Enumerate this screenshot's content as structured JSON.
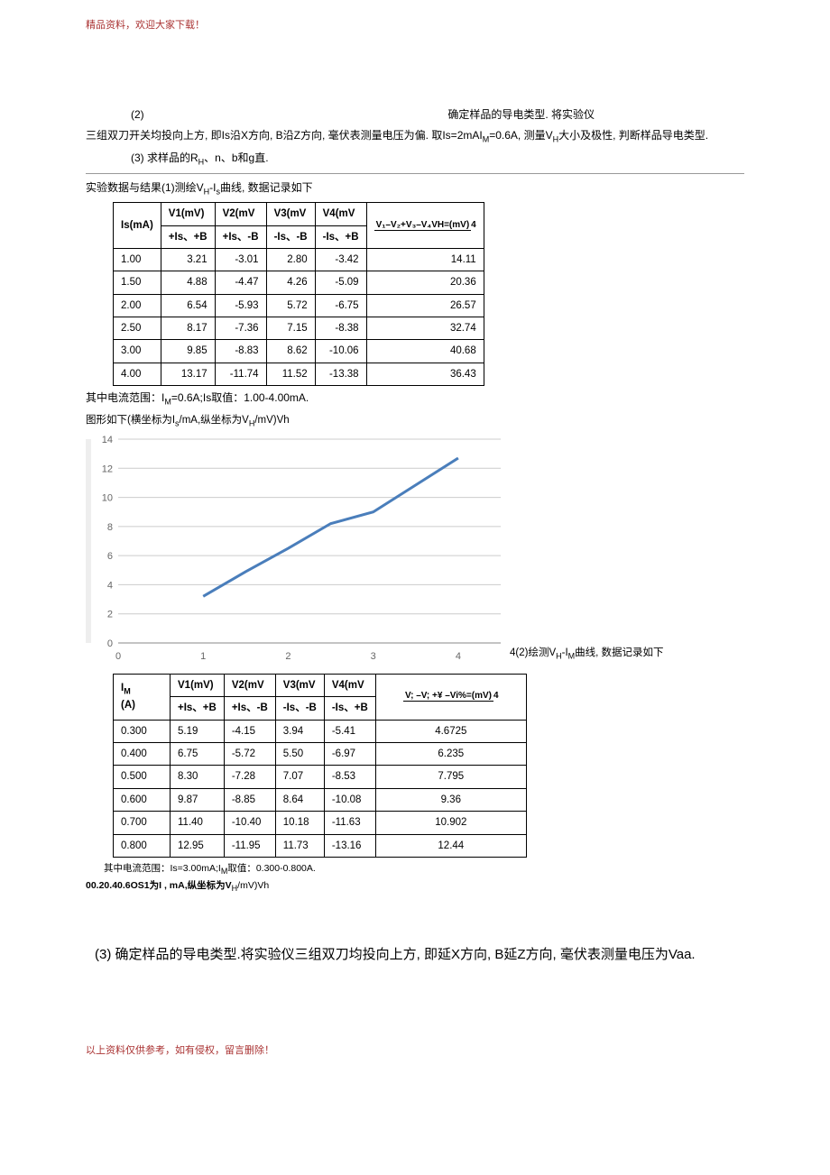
{
  "header_note": "精品资料，欢迎大家下载！",
  "footer_note": "以上资料仅供参考，如有侵权，留言删除！",
  "para_2_label": "(2)",
  "para_2_text_a": "确定样品的导电类型. 将实验仪",
  "para_2_text_b": "三组双刀开关均投向上方, 即Is沿X方向, B沿Z方向, 毫伏表测量电压为偏. 取Is=2mAI",
  "para_2_text_b2": "=0.6A, 测量V",
  "para_2_text_b3": "大小及极性, 判断样品导电类型.",
  "para_3": "(3)  求样品的R",
  "para_3_tail": "、n、b和g直.",
  "section_results_title": "实验数据与结果(1)测绘V",
  "section_results_tail": "曲线, 数据记录如下",
  "table1": {
    "head_Is": "Is(mA)",
    "head_V1": "V1(mV)",
    "head_V2": "V2(mV",
    "head_V3": "V3(mV",
    "head_V4": "V4(mV",
    "head_VH_num": "V₁–V₂+V₃–V₄VH=(mV)",
    "head_VH_den": "4",
    "sub_V1": "+Is、+B",
    "sub_V2": "+Is、-B",
    "sub_V3": "-Is、-B",
    "sub_V4": "-Is、+B",
    "rows": [
      {
        "is": "1.00",
        "v1": "3.21",
        "v2": "-3.01",
        "v3": "2.80",
        "v4": "-3.42",
        "vh": "14.11"
      },
      {
        "is": "1.50",
        "v1": "4.88",
        "v2": "-4.47",
        "v3": "4.26",
        "v4": "-5.09",
        "vh": "20.36"
      },
      {
        "is": "2.00",
        "v1": "6.54",
        "v2": "-5.93",
        "v3": "5.72",
        "v4": "-6.75",
        "vh": "26.57"
      },
      {
        "is": "2.50",
        "v1": "8.17",
        "v2": "-7.36",
        "v3": "7.15",
        "v4": "-8.38",
        "vh": "32.74"
      },
      {
        "is": "3.00",
        "v1": "9.85",
        "v2": "-8.83",
        "v3": "8.62",
        "v4": "-10.06",
        "vh": "40.68"
      },
      {
        "is": "4.00",
        "v1": "13.17",
        "v2": "-11.74",
        "v3": "11.52",
        "v4": "-13.38",
        "vh": "36.43"
      }
    ]
  },
  "table1_note": "其中电流范围：I",
  "table1_note_m": "=0.6A;Is取值：1.00-4.00mA.",
  "chart1_caption_a": "图形如下(横坐标为I",
  "chart1_caption_b": "/mA,纵坐标为V",
  "chart1_caption_c": "/mV)Vh",
  "chart1_right_text": "4(2)绘测V",
  "chart1_right_text2": "曲线, 数据记录如下",
  "table2": {
    "head_IM_a": "I",
    "head_IM_b": "(A)",
    "head_V1": "V1(mV)",
    "head_V2": "V2(mV",
    "head_V3": "V3(mV",
    "head_V4": "V4(mV",
    "head_VH_num": "V;  –V;  +¥ –Vi%=(mV)",
    "head_VH_den": "4",
    "sub_V1": "+Is、+B",
    "sub_V2": "+Is、-B",
    "sub_V3": "-Is、-B",
    "sub_V4": "-Is、+B",
    "rows": [
      {
        "im": "0.300",
        "v1": "5.19",
        "v2": "-4.15",
        "v3": "3.94",
        "v4": "-5.41",
        "vh": "4.6725"
      },
      {
        "im": "0.400",
        "v1": "6.75",
        "v2": "-5.72",
        "v3": "5.50",
        "v4": "-6.97",
        "vh": "6.235"
      },
      {
        "im": "0.500",
        "v1": "8.30",
        "v2": "-7.28",
        "v3": "7.07",
        "v4": "-8.53",
        "vh": "7.795"
      },
      {
        "im": "0.600",
        "v1": "9.87",
        "v2": "-8.85",
        "v3": "8.64",
        "v4": "-10.08",
        "vh": "9.36"
      },
      {
        "im": "0.700",
        "v1": "11.40",
        "v2": "-10.40",
        "v3": "10.18",
        "v4": "-11.63",
        "vh": "10.902"
      },
      {
        "im": "0.800",
        "v1": "12.95",
        "v2": "-11.95",
        "v3": "11.73",
        "v4": "-13.16",
        "vh": "12.44"
      }
    ]
  },
  "table2_note_a": "其中电流范围：Is=3.00mA;I",
  "table2_note_b": "取值：0.300-0.800A.",
  "chart2_caption": "00.20.40.6OS1为I , mA,纵坐标为V",
  "chart2_caption_tail": "/mV)Vh",
  "big_para": "(3) 确定样品的导电类型.将实验仪三组双刀均投向上方, 即延X方向, B延Z方向, 毫伏表测量电压为Vaa.",
  "chart_data": [
    {
      "type": "line",
      "title": "",
      "xlabel": "Is/mA",
      "ylabel": "Vh/mV",
      "xlim": [
        0,
        4.5
      ],
      "ylim": [
        0,
        14
      ],
      "xticks": [
        0,
        1,
        2,
        3,
        4
      ],
      "yticks": [
        0,
        2,
        4,
        6,
        8,
        10,
        12,
        14
      ],
      "x": [
        1.0,
        1.5,
        2.0,
        2.5,
        3.0,
        4.0
      ],
      "y": [
        3.2,
        4.9,
        6.5,
        8.2,
        9.0,
        12.7
      ]
    }
  ]
}
